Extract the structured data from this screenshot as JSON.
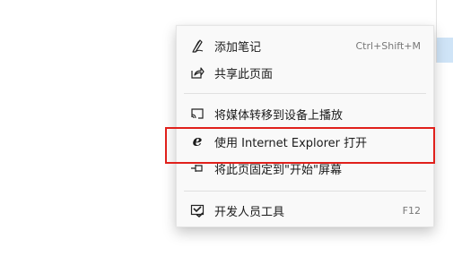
{
  "menu": {
    "items": [
      {
        "label": "添加笔记",
        "shortcut": "Ctrl+Shift+M",
        "icon": "pen-icon"
      },
      {
        "label": "共享此页面",
        "shortcut": "",
        "icon": "share-icon"
      },
      {
        "label": "将媒体转移到设备上播放",
        "shortcut": "",
        "icon": "cast-icon"
      },
      {
        "label": "使用 Internet Explorer 打开",
        "shortcut": "",
        "icon": "internet-explorer-icon"
      },
      {
        "label": "将此页固定到\"开始\"屏幕",
        "shortcut": "",
        "icon": "pin-icon"
      },
      {
        "label": "开发人员工具",
        "shortcut": "F12",
        "icon": "developer-tools-icon"
      }
    ]
  },
  "colors": {
    "highlight_border": "#e0201b",
    "menu_background": "#f9f9f9",
    "edge_highlight": "#cfe4f7"
  }
}
